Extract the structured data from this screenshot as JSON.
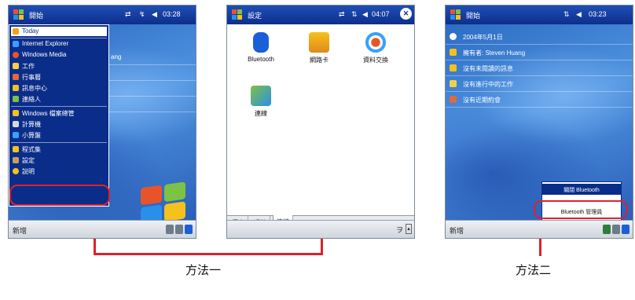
{
  "phone1": {
    "title": "開始",
    "time": "03:28",
    "today_fragment": "ang",
    "menu": [
      "Today",
      "Internet Explorer",
      "Windows Media",
      "工作",
      "行事曆",
      "訊息中心",
      "連絡人",
      "Windows 檔案總管",
      "計算機",
      "小算盤",
      "程式集",
      "設定",
      "說明"
    ],
    "softkey": "新增"
  },
  "phone2": {
    "title": "設定",
    "time": "04:07",
    "icons": [
      "Bluetooth",
      "網路卡",
      "資料交換",
      "連線"
    ],
    "tabs": [
      "個人",
      "系統",
      "連線"
    ],
    "input_glyph": "ヲ"
  },
  "phone3": {
    "title": "開始",
    "time": "03:23",
    "today_items": [
      "2004年5月1日",
      "擁有者: Steven Huang",
      "沒有未閱讀的訊息",
      "沒有進行中的工作",
      "沒有近期約會"
    ],
    "popup": [
      "關閉 Bluetooth",
      "Bluetooth 管理員",
      "Bluetooth 設定"
    ],
    "softkey": "新增"
  },
  "captions": {
    "method1": "方法一",
    "method2": "方法二"
  },
  "colors": {
    "highlight": "#e0202a",
    "title_bar": "#0d2e8c",
    "menu_bg": "#0b2d8a"
  }
}
